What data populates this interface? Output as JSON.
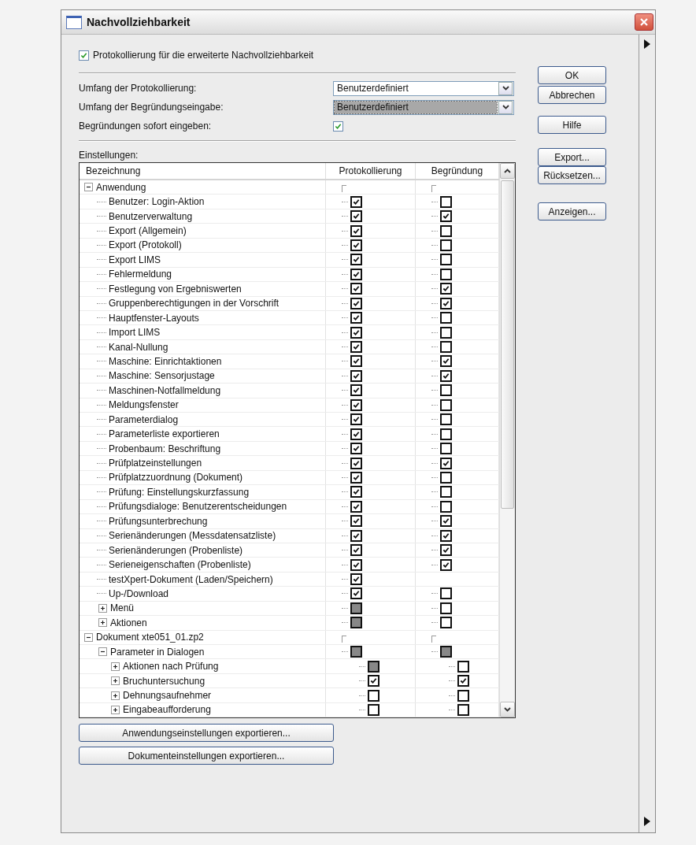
{
  "window": {
    "title": "Nachvollziehbarkeit"
  },
  "extended_logging": {
    "label": "Protokollierung für die erweiterte Nachvollziehbarkeit",
    "checked": true
  },
  "settings_rows": [
    {
      "kind": "combo",
      "label": "Umfang der Protokollierung:",
      "value": "Benutzerdefiniert",
      "highlighted": false
    },
    {
      "kind": "combo",
      "label": "Umfang der Begründungseingabe:",
      "value": "Benutzerdefiniert",
      "highlighted": true
    },
    {
      "kind": "checkbox",
      "label": "Begründungen sofort eingeben:",
      "checked": true
    }
  ],
  "settings_label": "Einstellungen:",
  "table": {
    "columns": [
      "Bezeichnung",
      "Protokollierung",
      "Begründung"
    ],
    "tree": [
      {
        "label": "Anwendung",
        "expanded": true,
        "children": [
          {
            "label": "Benutzer: Login-Aktion",
            "logging": {
              "kind": "checkbox",
              "checked": true
            },
            "justification": {
              "kind": "checkbox",
              "checked": false
            }
          },
          {
            "label": "Benutzerverwaltung",
            "logging": {
              "kind": "checkbox",
              "checked": true
            },
            "justification": {
              "kind": "checkbox",
              "checked": true
            }
          },
          {
            "label": "Export (Allgemein)",
            "logging": {
              "kind": "checkbox",
              "checked": true
            },
            "justification": {
              "kind": "checkbox",
              "checked": false
            }
          },
          {
            "label": "Export (Protokoll)",
            "logging": {
              "kind": "checkbox",
              "checked": true
            },
            "justification": {
              "kind": "checkbox",
              "checked": false
            }
          },
          {
            "label": "Export LIMS",
            "logging": {
              "kind": "checkbox",
              "checked": true
            },
            "justification": {
              "kind": "checkbox",
              "checked": false
            }
          },
          {
            "label": "Fehlermeldung",
            "logging": {
              "kind": "checkbox",
              "checked": true
            },
            "justification": {
              "kind": "checkbox",
              "checked": false
            }
          },
          {
            "label": "Festlegung von Ergebniswerten",
            "logging": {
              "kind": "checkbox",
              "checked": true
            },
            "justification": {
              "kind": "checkbox",
              "checked": true
            }
          },
          {
            "label": "Gruppenberechtigungen in der Vorschrift",
            "logging": {
              "kind": "checkbox",
              "checked": true
            },
            "justification": {
              "kind": "checkbox",
              "checked": true
            }
          },
          {
            "label": "Hauptfenster-Layouts",
            "logging": {
              "kind": "checkbox",
              "checked": true
            },
            "justification": {
              "kind": "checkbox",
              "checked": false
            }
          },
          {
            "label": "Import LIMS",
            "logging": {
              "kind": "checkbox",
              "checked": true
            },
            "justification": {
              "kind": "checkbox",
              "checked": false
            }
          },
          {
            "label": "Kanal-Nullung",
            "logging": {
              "kind": "checkbox",
              "checked": true
            },
            "justification": {
              "kind": "checkbox",
              "checked": false
            }
          },
          {
            "label": "Maschine: Einrichtaktionen",
            "logging": {
              "kind": "checkbox",
              "checked": true
            },
            "justification": {
              "kind": "checkbox",
              "checked": true
            }
          },
          {
            "label": "Maschine: Sensorjustage",
            "logging": {
              "kind": "checkbox",
              "checked": true
            },
            "justification": {
              "kind": "checkbox",
              "checked": true
            }
          },
          {
            "label": "Maschinen-Notfallmeldung",
            "logging": {
              "kind": "checkbox",
              "checked": true
            },
            "justification": {
              "kind": "checkbox",
              "checked": false
            }
          },
          {
            "label": "Meldungsfenster",
            "logging": {
              "kind": "checkbox",
              "checked": true
            },
            "justification": {
              "kind": "checkbox",
              "checked": false
            }
          },
          {
            "label": "Parameterdialog",
            "logging": {
              "kind": "checkbox",
              "checked": true
            },
            "justification": {
              "kind": "checkbox",
              "checked": false
            }
          },
          {
            "label": "Parameterliste exportieren",
            "logging": {
              "kind": "checkbox",
              "checked": true
            },
            "justification": {
              "kind": "checkbox",
              "checked": false
            }
          },
          {
            "label": "Probenbaum: Beschriftung",
            "logging": {
              "kind": "checkbox",
              "checked": true
            },
            "justification": {
              "kind": "checkbox",
              "checked": false
            }
          },
          {
            "label": "Prüfplatzeinstellungen",
            "logging": {
              "kind": "checkbox",
              "checked": true
            },
            "justification": {
              "kind": "checkbox",
              "checked": true
            }
          },
          {
            "label": "Prüfplatzzuordnung (Dokument)",
            "logging": {
              "kind": "checkbox",
              "checked": true
            },
            "justification": {
              "kind": "checkbox",
              "checked": false
            }
          },
          {
            "label": "Prüfung: Einstellungskurzfassung",
            "logging": {
              "kind": "checkbox",
              "checked": true
            },
            "justification": {
              "kind": "checkbox",
              "checked": false
            }
          },
          {
            "label": "Prüfungsdialoge: Benutzerentscheidungen",
            "logging": {
              "kind": "checkbox",
              "checked": true
            },
            "justification": {
              "kind": "checkbox",
              "checked": false
            }
          },
          {
            "label": "Prüfungsunterbrechung",
            "logging": {
              "kind": "checkbox",
              "checked": true
            },
            "justification": {
              "kind": "checkbox",
              "checked": true
            }
          },
          {
            "label": "Serienänderungen (Messdatensatzliste)",
            "logging": {
              "kind": "checkbox",
              "checked": true
            },
            "justification": {
              "kind": "checkbox",
              "checked": true
            }
          },
          {
            "label": "Serienänderungen (Probenliste)",
            "logging": {
              "kind": "checkbox",
              "checked": true
            },
            "justification": {
              "kind": "checkbox",
              "checked": true
            }
          },
          {
            "label": "Serieneigenschaften (Probenliste)",
            "logging": {
              "kind": "checkbox",
              "checked": true
            },
            "justification": {
              "kind": "checkbox",
              "checked": true
            }
          },
          {
            "label": "testXpert-Dokument (Laden/Speichern)",
            "logging": {
              "kind": "checkbox",
              "checked": true
            }
          },
          {
            "label": "Up-/Download",
            "logging": {
              "kind": "checkbox",
              "checked": true
            },
            "justification": {
              "kind": "checkbox",
              "checked": false
            }
          },
          {
            "label": "Menü",
            "expanded": false,
            "logging": {
              "kind": "partial",
              "indeterminate": true
            },
            "justification": {
              "kind": "checkbox",
              "checked": false
            }
          },
          {
            "label": "Aktionen",
            "expanded": false,
            "logging": {
              "kind": "partial",
              "indeterminate": true
            },
            "justification": {
              "kind": "checkbox",
              "checked": false
            }
          }
        ]
      },
      {
        "label": "Dokument xte051_01.zp2",
        "expanded": true,
        "children": [
          {
            "label": "Parameter in Dialogen",
            "expanded": true,
            "logging": {
              "kind": "partial",
              "indeterminate": true
            },
            "justification": {
              "kind": "partial",
              "indeterminate": true
            },
            "children": [
              {
                "label": "Aktionen nach Prüfung",
                "expanded": false,
                "logging": {
                  "kind": "partial",
                  "indeterminate": true
                },
                "justification": {
                  "kind": "checkbox",
                  "checked": false
                }
              },
              {
                "label": "Bruchuntersuchung",
                "expanded": false,
                "logging": {
                  "kind": "checkbox",
                  "checked": true
                },
                "justification": {
                  "kind": "checkbox",
                  "checked": true
                }
              },
              {
                "label": "Dehnungsaufnehmer",
                "expanded": false,
                "logging": {
                  "kind": "checkbox",
                  "checked": false
                },
                "justification": {
                  "kind": "checkbox",
                  "checked": false
                }
              },
              {
                "label": "Eingabeaufforderung",
                "expanded": false,
                "logging": {
                  "kind": "checkbox",
                  "checked": false
                },
                "justification": {
                  "kind": "checkbox",
                  "checked": false
                }
              }
            ]
          }
        ]
      }
    ]
  },
  "bottom_buttons": [
    "Anwendungseinstellungen exportieren...",
    "Dokumenteinstellungen exportieren..."
  ],
  "side_buttons": [
    "OK",
    "Abbrechen",
    "Hilfe",
    "Export...",
    "Rücksetzen...",
    "Anzeigen..."
  ]
}
